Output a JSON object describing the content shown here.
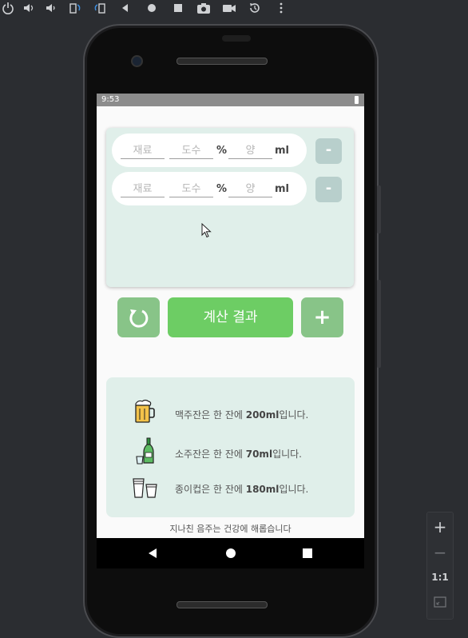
{
  "emulator": {
    "toolbar_icons": [
      "power-icon",
      "volume-up-icon",
      "volume-down-icon",
      "rotate-left-icon",
      "rotate-right-icon",
      "back-icon",
      "home-icon",
      "overview-icon",
      "screenshot-icon",
      "camera-icon",
      "replay-icon",
      "more-icon"
    ],
    "zoom_panel": {
      "zoom_in": "+",
      "zoom_out": "−",
      "actual_size": "1:1"
    }
  },
  "status_bar": {
    "time": "9:53"
  },
  "ingredients": [
    {
      "name_placeholder": "재료",
      "abv_placeholder": "도수",
      "abv_unit": "%",
      "amount_placeholder": "양",
      "amount_unit": "ml",
      "remove_label": "-"
    },
    {
      "name_placeholder": "재료",
      "abv_placeholder": "도수",
      "abv_unit": "%",
      "amount_placeholder": "양",
      "amount_unit": "ml",
      "remove_label": "-"
    }
  ],
  "actions": {
    "calculate_label": "계산 결과",
    "add_label": "+"
  },
  "info": [
    {
      "prefix": "맥주잔은 한 잔에 ",
      "amount": "200ml",
      "suffix": "입니다.",
      "icon": "beer-mug-icon"
    },
    {
      "prefix": "소주잔은 한 잔에 ",
      "amount": "70ml",
      "suffix": "입니다.",
      "icon": "soju-bottle-icon"
    },
    {
      "prefix": "종이컵은 한 잔에 ",
      "amount": "180ml",
      "suffix": "입니다.",
      "icon": "paper-cup-icon"
    }
  ],
  "footer": "지나친 음주는 건강에 해롭습니다",
  "colors": {
    "card_bg": "#e0efea",
    "calc_button": "#6dcd64",
    "secondary_button": "#88c488",
    "remove_button": "#b8cfcc"
  }
}
